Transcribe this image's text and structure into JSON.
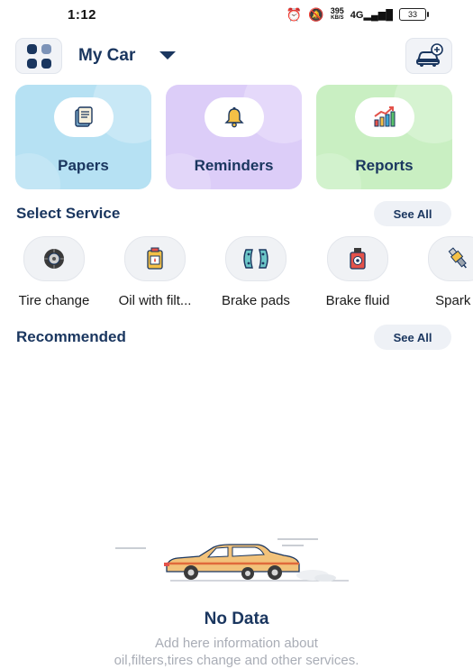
{
  "status_bar": {
    "time": "1:12",
    "net_speed": "395",
    "net_unit": "KB/S",
    "network_type": "4G",
    "battery": "33"
  },
  "header": {
    "title": "My Car",
    "menu_icon": "grid-menu-icon",
    "add_car_icon": "car-add-icon"
  },
  "quick_cards": [
    {
      "label": "Papers",
      "icon": "documents-icon",
      "color": "#b6e1f3"
    },
    {
      "label": "Reminders",
      "icon": "bell-icon",
      "color": "#dccdf8"
    },
    {
      "label": "Reports",
      "icon": "chart-icon",
      "color": "#c9efc2"
    }
  ],
  "select_service": {
    "title": "Select Service",
    "see_all": "See All",
    "items": [
      {
        "label": "Tire change",
        "icon": "tire-icon"
      },
      {
        "label": "Oil with filt...",
        "icon": "oil-can-icon"
      },
      {
        "label": "Brake pads",
        "icon": "brake-pads-icon"
      },
      {
        "label": "Brake fluid",
        "icon": "brake-fluid-icon"
      },
      {
        "label": "Spark p",
        "icon": "spark-plug-icon"
      }
    ]
  },
  "recommended": {
    "title": "Recommended",
    "see_all": "See All"
  },
  "empty_state": {
    "title": "No Data",
    "line1": "Add here information about",
    "line2": "oil,filters,tires change and other services."
  },
  "colors": {
    "primary": "#1a365f",
    "muted_text": "#a9adb6",
    "pill_bg": "#eef1f6",
    "car_body": "#f2c27a"
  }
}
